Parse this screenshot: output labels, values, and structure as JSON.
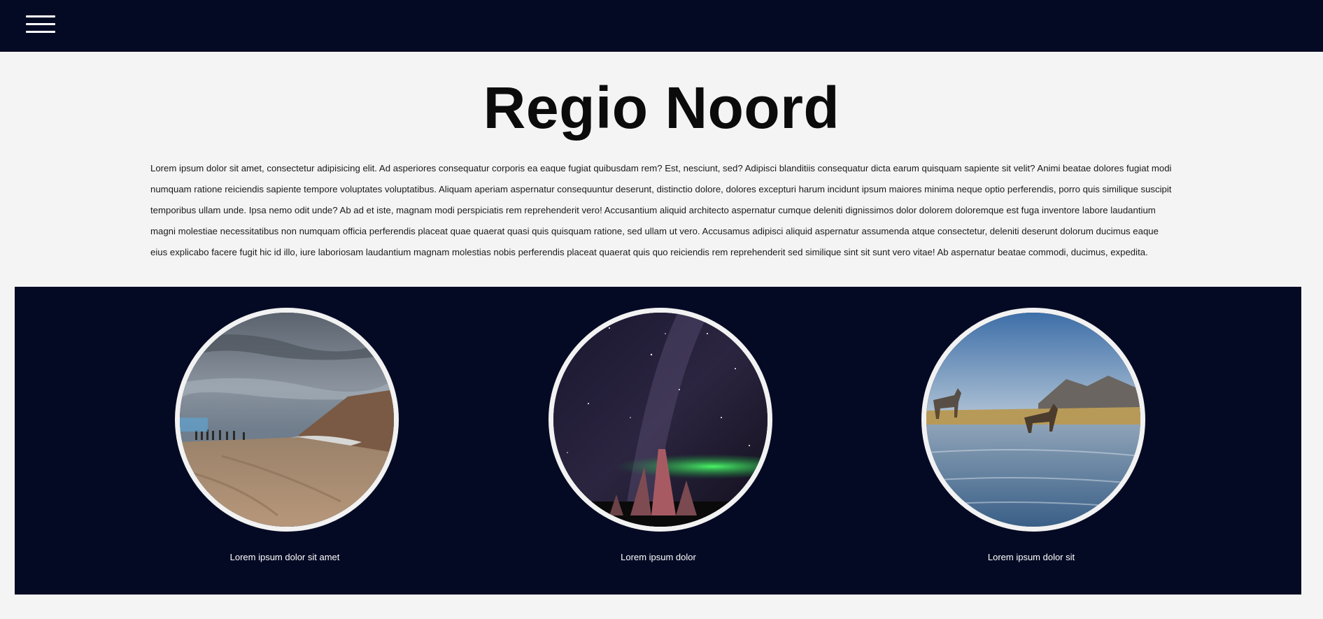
{
  "header": {
    "menu_icon": "hamburger-menu-icon",
    "background_color": "#050a24"
  },
  "main": {
    "title": "Regio Noord",
    "intro": "Lorem ipsum dolor sit amet, consectetur adipisicing elit. Ad asperiores consequatur corporis ea eaque fugiat quibusdam rem? Est, nesciunt, sed? Adipisci blanditiis consequatur dicta earum quisquam sapiente sit velit? Animi beatae dolores fugiat modi numquam ratione reiciendis sapiente tempore voluptates voluptatibus. Aliquam aperiam aspernatur consequuntur deserunt, distinctio dolore, dolores excepturi harum incidunt ipsum maiores minima neque optio perferendis, porro quis similique suscipit temporibus ullam unde. Ipsa nemo odit unde? Ab ad et iste, magnam modi perspiciatis rem reprehenderit vero! Accusantium aliquid architecto aspernatur cumque deleniti dignissimos dolor dolorem doloremque est fuga inventore labore laudantium magni molestiae necessitatibus non numquam officia perferendis placeat quae quaerat quasi quis quisquam ratione, sed ullam ut vero. Accusamus adipisci aliquid aspernatur assumenda atque consectetur, deleniti deserunt dolorum ducimus eaque eius explicabo facere fugit hic id illo, iure laboriosam laudantium magnam molestias nobis perferendis placeat quaerat quis quo reiciendis rem reprehenderit sed similique sint sit sunt vero vitae! Ab aspernatur beatae commodi, ducimus, expedita."
  },
  "gallery": {
    "background_color": "#050a24",
    "items": [
      {
        "caption": "Lorem ipsum dolor sit amet",
        "image": "geothermal-landscape-photo"
      },
      {
        "caption": "Lorem ipsum dolor",
        "image": "night-sky-aurora-photo"
      },
      {
        "caption": "Lorem ipsum dolor sit",
        "image": "horses-in-river-photo"
      }
    ]
  }
}
